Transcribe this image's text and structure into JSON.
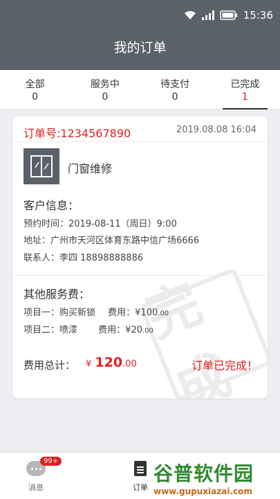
{
  "status_bar": {
    "time": "15:36"
  },
  "header": {
    "title": "我的订单"
  },
  "tabs": [
    {
      "label": "全部",
      "count": "0"
    },
    {
      "label": "服务中",
      "count": "0"
    },
    {
      "label": "待支付",
      "count": "0"
    },
    {
      "label": "已完成",
      "count": "1"
    }
  ],
  "order": {
    "number": "订单号:1234567890",
    "datetime": "2019.08.08  16:04",
    "service_name": "门窗维修",
    "customer_title": "客户信息：",
    "appointment": "预约时间：2019-08-11（周日）9:00",
    "address": "地址：广州市天河区体育东路中信广场6666",
    "contact": "联系人：李四   18898888886",
    "other_fees_title": "其他服务费：",
    "items": [
      {
        "label": "项目一：购买新锁",
        "fee_label": "费用：",
        "fee_main": "¥100",
        "fee_dec": ".00"
      },
      {
        "label": "项目二：喷漆",
        "fee_label": "费用：",
        "fee_main": "¥20",
        "fee_dec": ".00"
      }
    ],
    "total_label": "费用总计：",
    "total_currency": "¥",
    "total_main": "120",
    "total_dec": ".00",
    "status": "订单已完成！",
    "stamp_text": "完成"
  },
  "bottom_nav": {
    "messages_label": "消息",
    "messages_badge": "99+",
    "orders_label": "订单"
  },
  "watermark": {
    "text": "谷普软件园",
    "url": "www.gupuxiazai.com"
  }
}
